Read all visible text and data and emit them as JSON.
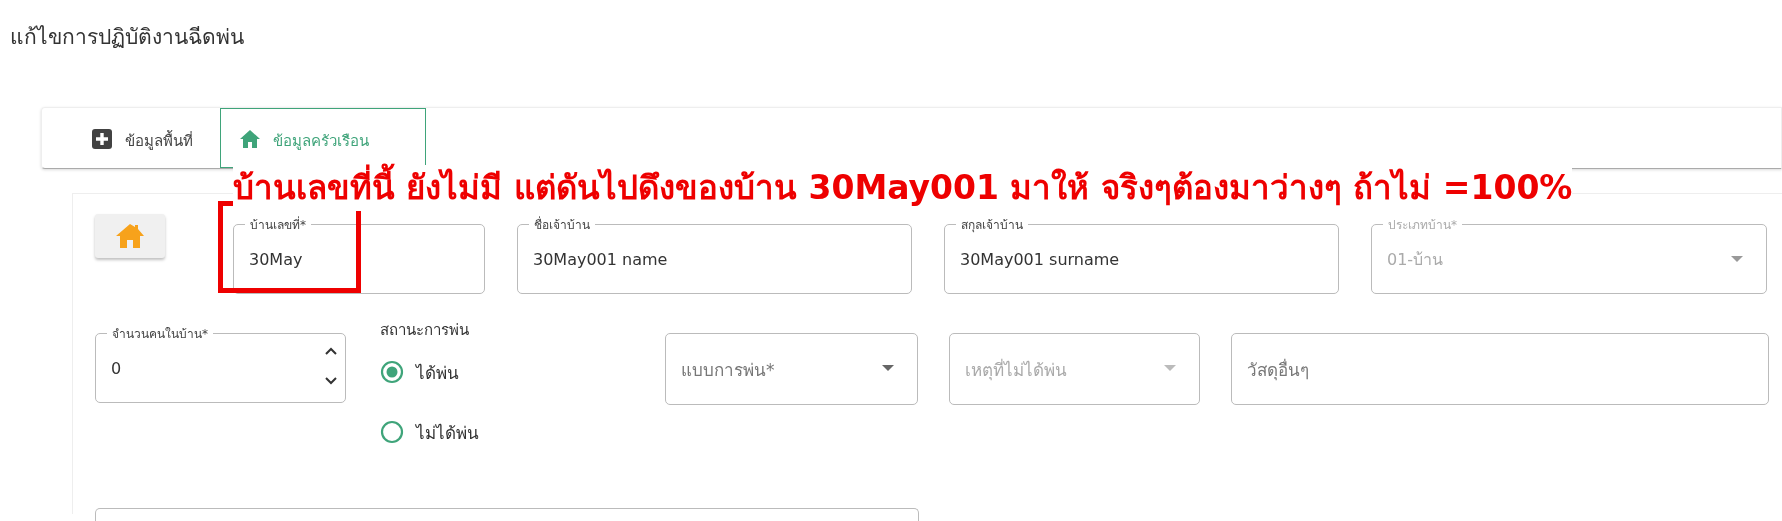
{
  "page_title": "แก้ไขการปฏิบัติงานฉีดพ่น",
  "tabs": [
    {
      "label": "ข้อมูลพื้นที่",
      "selected": false
    },
    {
      "label": "ข้อมูลครัวเรือน",
      "selected": true
    }
  ],
  "annotation": {
    "text": "บ้านเลขที่นี้ ยังไม่มี แต่ดันไปดึงของบ้าน 30May001 มาให้ จริงๆต้องมาว่างๆ ถ้าไม่ =100%"
  },
  "form": {
    "row_1": [
      {
        "kind": "text",
        "label": "บ้านเลขที่*",
        "value": "30May",
        "highlighted": true,
        "disabled": false
      },
      {
        "kind": "text",
        "label": "ชื่อเจ้าบ้าน",
        "value": "30May001 name",
        "highlighted": false,
        "disabled": false
      },
      {
        "kind": "text",
        "label": "สกุลเจ้าบ้าน",
        "value": "30May001 surname",
        "highlighted": false,
        "disabled": false
      },
      {
        "kind": "select",
        "label": "ประเภทบ้าน*",
        "value": "01-บ้าน",
        "highlighted": false,
        "disabled": true
      }
    ],
    "number_field": {
      "label": "จำนวนคนในบ้าน*",
      "value": "0"
    },
    "spray_status": {
      "label": "สถานะการพ่น",
      "options": [
        {
          "label": "ได้พ่น",
          "selected": true
        },
        {
          "label": "ไม่ได้พ่น",
          "selected": false
        }
      ]
    },
    "row_2": [
      {
        "kind": "select",
        "placeholder": "แบบการพ่น*",
        "disabled": false
      },
      {
        "kind": "select",
        "placeholder": "เหตุที่ไม่ได้พ่น",
        "disabled": true
      },
      {
        "kind": "text",
        "placeholder": "วัสดุอื่นๆ",
        "disabled": false
      }
    ]
  }
}
